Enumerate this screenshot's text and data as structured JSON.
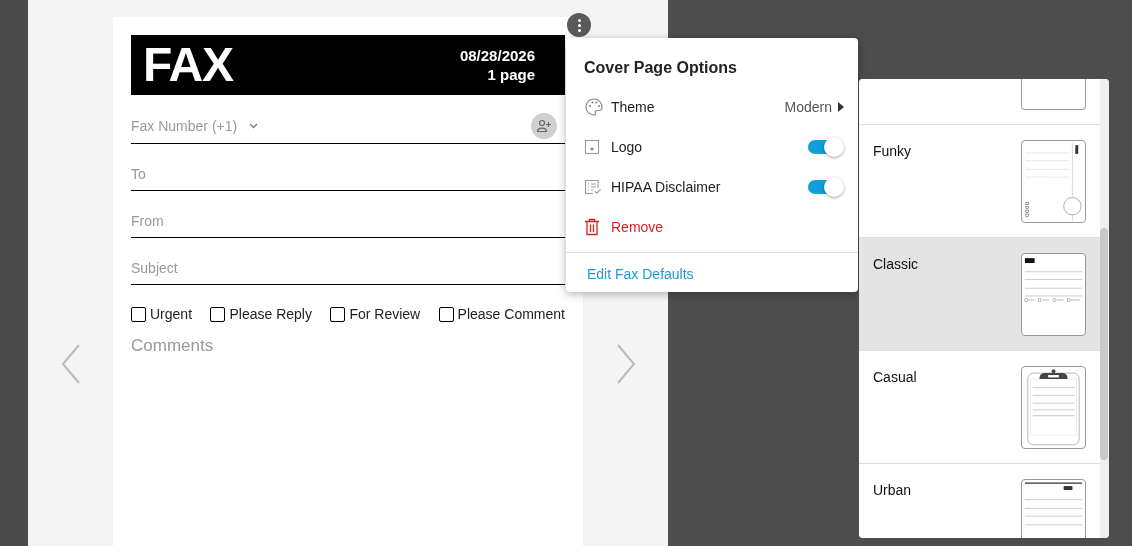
{
  "cover_page": {
    "title": "FAX",
    "date": "08/28/2026",
    "page_count": "1 page"
  },
  "fields": [
    {
      "kind": "phone",
      "placeholder": "Fax Number (+1)"
    },
    {
      "kind": "text",
      "placeholder": "To"
    },
    {
      "kind": "text",
      "placeholder": "From"
    },
    {
      "kind": "text",
      "placeholder": "Subject"
    }
  ],
  "checkboxes": [
    {
      "label": "Urgent",
      "checked": false
    },
    {
      "label": "Please Reply",
      "checked": false
    },
    {
      "label": "For Review",
      "checked": false
    },
    {
      "label": "Please Comment",
      "checked": false
    }
  ],
  "comments": {
    "placeholder": "Comments"
  },
  "options_menu": {
    "title": "Cover Page Options",
    "items": [
      {
        "kind": "submenu",
        "label": "Theme",
        "value": "Modern"
      },
      {
        "kind": "toggle",
        "label": "Logo",
        "on": true
      },
      {
        "kind": "toggle",
        "label": "HIPAA Disclaimer",
        "on": true
      },
      {
        "kind": "danger",
        "label": "Remove"
      }
    ],
    "footer_link": "Edit Fax Defaults"
  },
  "themes": [
    {
      "kind": "cut",
      "selected": false
    },
    {
      "kind": "funky",
      "label": "Funky",
      "selected": false
    },
    {
      "kind": "classic",
      "label": "Classic",
      "selected": true
    },
    {
      "kind": "casual",
      "label": "Casual",
      "selected": false
    },
    {
      "kind": "urban",
      "label": "Urban",
      "selected": false
    }
  ]
}
